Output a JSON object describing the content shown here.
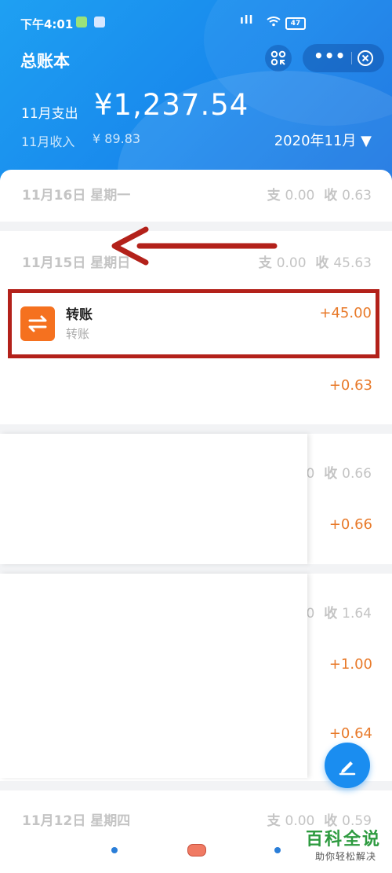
{
  "status_bar": {
    "time": "下午4:01",
    "signal": "ıll",
    "battery": "47"
  },
  "header": {
    "title": "总账本",
    "expense_label": "11月支出",
    "expense_amount": "¥1,237.54",
    "income_label": "11月收入",
    "income_amount": "¥ 89.83",
    "month": "2020年11月 ▼",
    "more_label": "•••"
  },
  "groups": [
    {
      "date": "11月16日 星期一",
      "out_label": "支",
      "out": "0.00",
      "in_label": "收",
      "in": "0.63"
    },
    {
      "date": "11月15日 星期日",
      "out_label": "支",
      "out": "0.00",
      "in_label": "收",
      "in": "45.63"
    },
    {
      "date": "11月12日 星期四",
      "out_label": "支",
      "out": "0.00",
      "in_label": "收",
      "in": "0.59"
    }
  ],
  "transaction": {
    "name": "转账",
    "sub": "转账",
    "amount": "+45.00"
  },
  "amounts": [
    "+0.63",
    "+0.66",
    "+1.00",
    "+0.64"
  ],
  "partial_sums": [
    {
      "out_tail": "0",
      "in_label": "收",
      "in": "0.66"
    },
    {
      "out_tail": "0",
      "in_label": "收",
      "in": "1.64"
    }
  ],
  "watermark": {
    "title": "百科全说",
    "subtitle": "助你轻松解决"
  },
  "colors": {
    "header_blue": "#1887ec",
    "income_orange": "#e87a2a",
    "highlight_red": "#b3211a",
    "icon_orange": "#f5711f"
  }
}
